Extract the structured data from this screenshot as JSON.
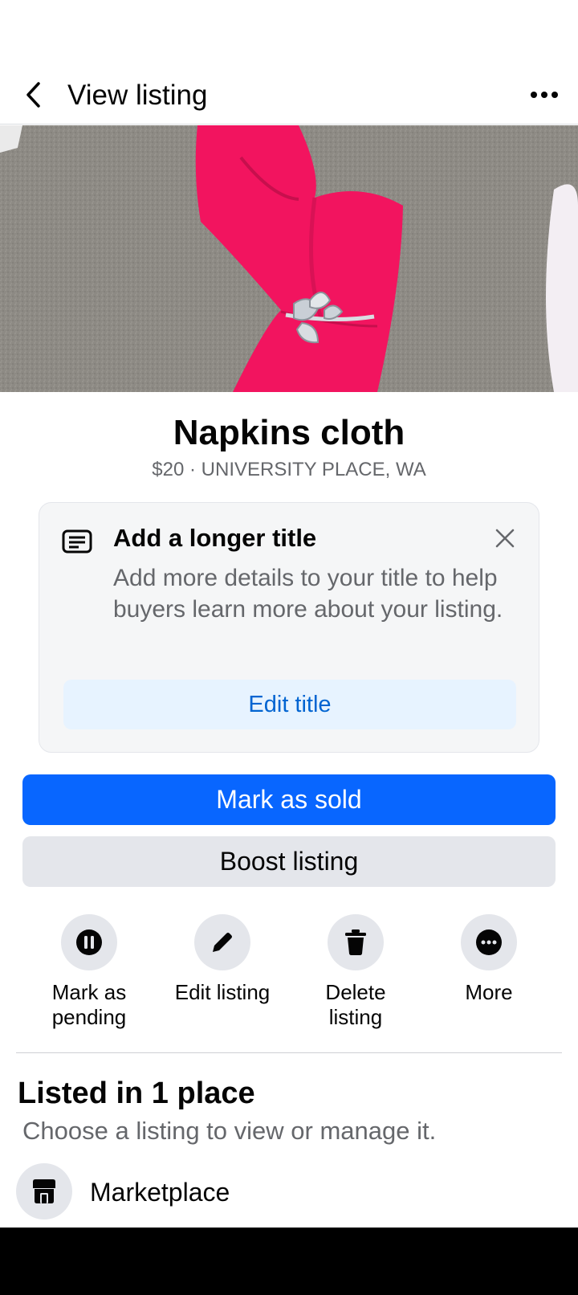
{
  "header": {
    "title": "View listing"
  },
  "listing": {
    "title": "Napkins cloth",
    "meta": "$20 · UNIVERSITY PLACE, WA"
  },
  "tip_card": {
    "title": "Add a longer title",
    "body": "Add more details to your title to help buyers learn more about your listing.",
    "button": "Edit title"
  },
  "buttons": {
    "primary": "Mark as sold",
    "secondary": "Boost listing"
  },
  "actions": [
    {
      "label": "Mark as\npending",
      "icon": "pause-icon"
    },
    {
      "label": "Edit listing",
      "icon": "pencil-icon"
    },
    {
      "label": "Delete\nlisting",
      "icon": "trash-icon"
    },
    {
      "label": "More",
      "icon": "more-dots-icon"
    }
  ],
  "section": {
    "title": "Listed in 1 place",
    "subtitle": "Choose a listing to view or manage it."
  },
  "places": [
    {
      "label": "Marketplace",
      "icon": "storefront-icon"
    }
  ],
  "colors": {
    "primary_button": "#0866ff",
    "secondary_button": "#e4e6eb",
    "tip_button_bg": "#e7f3ff",
    "tip_button_text": "#0064d1",
    "napkin": "#f2145f"
  }
}
